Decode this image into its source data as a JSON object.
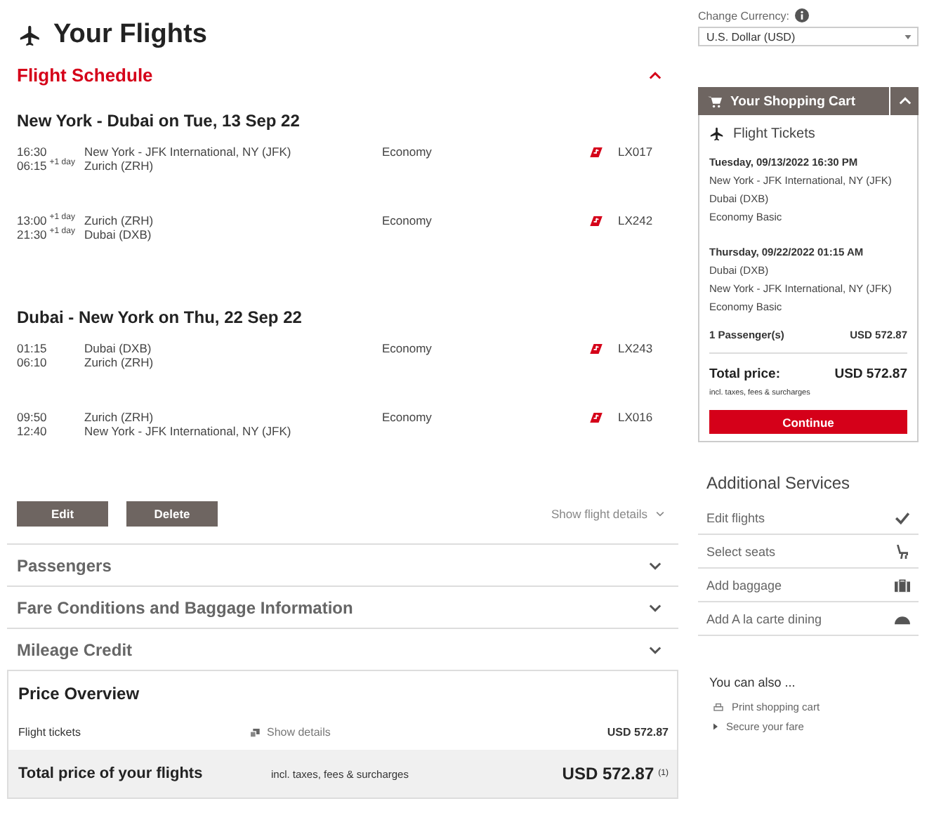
{
  "page_title": "Your Flights",
  "schedule": {
    "title": "Flight Schedule",
    "expanded": true,
    "journeys": [
      {
        "title": "New York - Dubai on Tue, 13 Sep 22",
        "flights": [
          {
            "dep_time": "16:30",
            "arr_time": "06:15",
            "arr_sup": "+1 day",
            "from": "New York - JFK International, NY (JFK)",
            "to": "Zurich (ZRH)",
            "cabin": "Economy",
            "code": "LX017"
          },
          {
            "dep_time": "13:00",
            "dep_sup": "+1 day",
            "arr_time": "21:30",
            "arr_sup": "+1 day",
            "from": "Zurich (ZRH)",
            "to": "Dubai (DXB)",
            "cabin": "Economy",
            "code": "LX242"
          }
        ]
      },
      {
        "title": "Dubai - New York on Thu, 22 Sep 22",
        "flights": [
          {
            "dep_time": "01:15",
            "arr_time": "06:10",
            "from": "Dubai (DXB)",
            "to": "Zurich (ZRH)",
            "cabin": "Economy",
            "code": "LX243"
          },
          {
            "dep_time": "09:50",
            "arr_time": "12:40",
            "from": "Zurich (ZRH)",
            "to": "New York - JFK International, NY (JFK)",
            "cabin": "Economy",
            "code": "LX016"
          }
        ]
      }
    ],
    "buttons": [
      "Edit",
      "Delete"
    ],
    "details_link": "Show flight details"
  },
  "sections": [
    {
      "title": "Passengers",
      "expanded": false
    },
    {
      "title": "Fare Conditions and Baggage Information",
      "expanded": false
    },
    {
      "title": "Mileage Credit",
      "expanded": false
    }
  ],
  "price_overview": {
    "title": "Price Overview",
    "item_label": "Flight tickets",
    "details_link": "Show details",
    "item_price": "USD 572.87",
    "total_label": "Total price of your flights",
    "total_note": "incl. taxes, fees & surcharges",
    "total_price": "USD 572.87",
    "footnote": "(1)"
  },
  "currency": {
    "label": "Change Currency:",
    "value": "U.S. Dollar (USD)"
  },
  "cart": {
    "title": "Your Shopping Cart",
    "expanded": true,
    "section": "Flight Tickets",
    "legs": [
      {
        "date": "Tuesday, 09/13/2022 16:30 PM",
        "lines": [
          "New York - JFK International, NY (JFK)",
          "Dubai (DXB)",
          "Economy Basic"
        ]
      },
      {
        "date": "Thursday, 09/22/2022 01:15 AM",
        "lines": [
          "Dubai (DXB)",
          "New York - JFK International, NY (JFK)",
          "Economy Basic"
        ]
      }
    ],
    "passengers": "1 Passenger(s)",
    "passengers_price": "USD 572.87",
    "total_label": "Total price:",
    "total_price": "USD 572.87",
    "total_note": "incl. taxes, fees & surcharges",
    "button": "Continue"
  },
  "services": {
    "title": "Additional Services",
    "items": [
      {
        "label": "Edit flights",
        "kind": "check"
      },
      {
        "label": "Select seats",
        "kind": "seat"
      },
      {
        "label": "Add baggage",
        "kind": "baggage"
      },
      {
        "label": "Add A la carte dining",
        "kind": "dining"
      }
    ]
  },
  "also": {
    "title": "You can also ...",
    "links": [
      {
        "label": "Print shopping cart",
        "kind": "print"
      },
      {
        "label": "Secure your fare",
        "kind": "arrow"
      }
    ]
  }
}
